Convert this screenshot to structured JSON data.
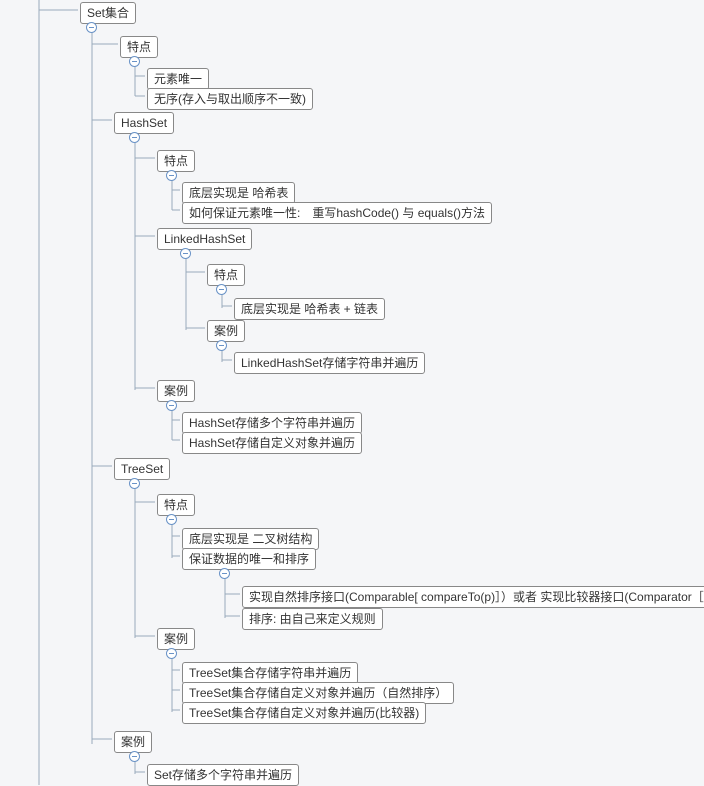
{
  "tree": {
    "root": "Set集合",
    "features_label": "特点",
    "features": {
      "unique": "元素唯一",
      "unordered": "无序(存入与取出顺序不一致)"
    },
    "hashset": {
      "label": "HashSet",
      "features_label": "特点",
      "features": {
        "impl": "底层实现是 哈希表",
        "uniqueness": "如何保证元素唯一性:　重写hashCode() 与 equals()方法"
      },
      "linkedhashset": {
        "label": "LinkedHashSet",
        "features_label": "特点",
        "features": {
          "impl": "底层实现是 哈希表 + 链表"
        },
        "examples_label": "案例",
        "examples": {
          "e1": "LinkedHashSet存储字符串并遍历"
        }
      },
      "examples_label": "案例",
      "examples": {
        "e1": "HashSet存储多个字符串并遍历",
        "e2": "HashSet存储自定义对象并遍历"
      }
    },
    "treeset": {
      "label": "TreeSet",
      "features_label": "特点",
      "features": {
        "impl": "底层实现是 二叉树结构",
        "guarantee": "保证数据的唯一和排序",
        "sort_if": "实现自然排序接口(Comparable[ compareTo(p)］）或者 实现比较器接口(Comparator［",
        "sort_rule": "排序: 由自己来定义规则"
      },
      "examples_label": "案例",
      "examples": {
        "e1": "TreeSet集合存储字符串并遍历",
        "e2": "TreeSet集合存储自定义对象并遍历（自然排序）",
        "e3": "TreeSet集合存储自定义对象并遍历(比较器)"
      }
    },
    "examples_label": "案例",
    "examples": {
      "e1": "Set存储多个字符串并遍历"
    }
  }
}
